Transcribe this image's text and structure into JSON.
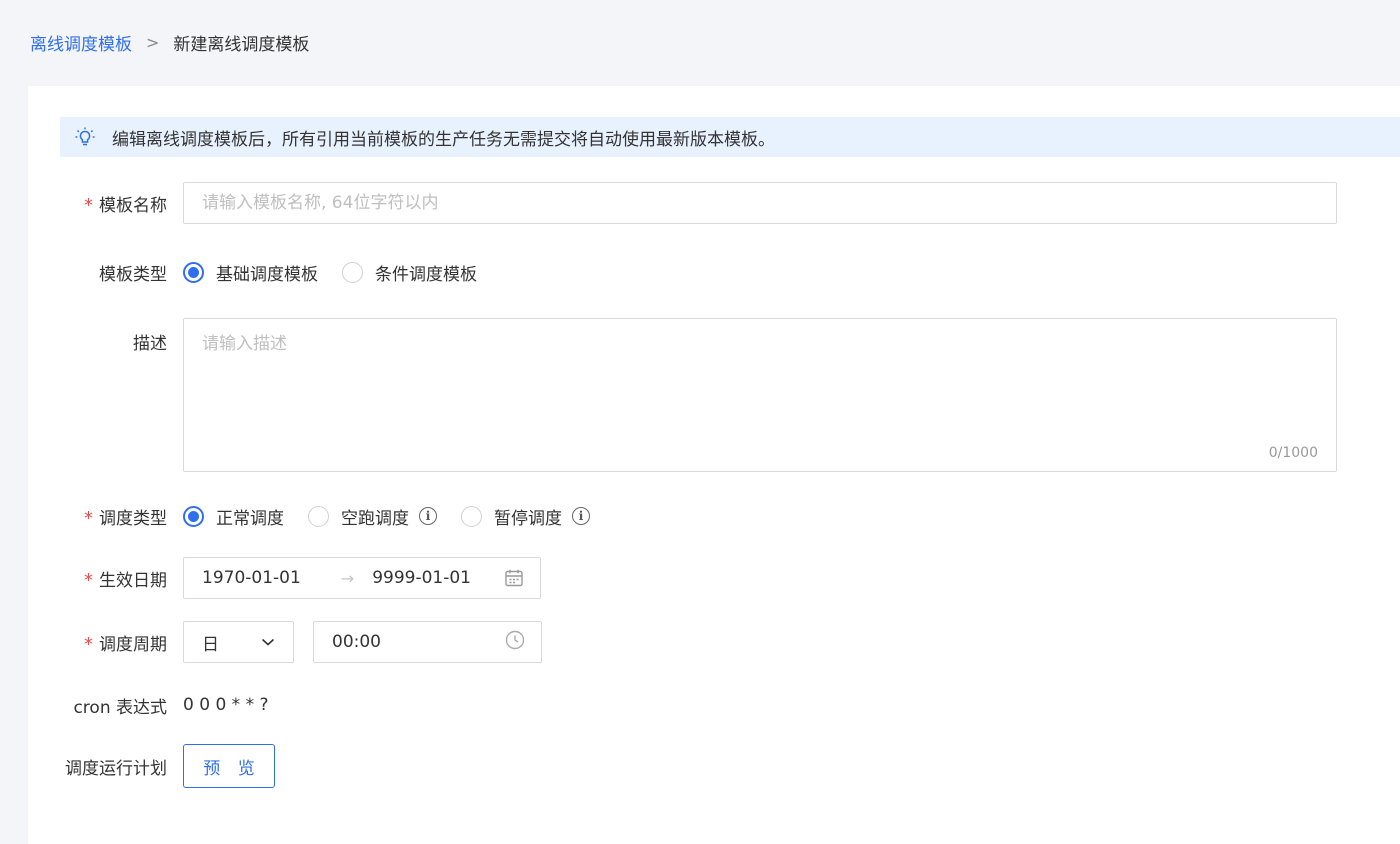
{
  "breadcrumb": {
    "parent": "离线调度模板",
    "separator": ">",
    "current": "新建离线调度模板"
  },
  "notice": {
    "icon": "lightbulb-icon",
    "text": "编辑离线调度模板后，所有引用当前模板的生产任务无需提交将自动使用最新版本模板。"
  },
  "form": {
    "name": {
      "label": "模板名称",
      "required": "*",
      "placeholder": "请输入模板名称, 64位字符以内",
      "value": ""
    },
    "template_type": {
      "label": "模板类型",
      "options": [
        {
          "label": "基础调度模板",
          "checked": true
        },
        {
          "label": "条件调度模板",
          "checked": false
        }
      ]
    },
    "description": {
      "label": "描述",
      "placeholder": "请输入描述",
      "value": "",
      "counter": "0/1000"
    },
    "schedule_type": {
      "label": "调度类型",
      "required": "*",
      "options": [
        {
          "label": "正常调度",
          "checked": true,
          "info": false
        },
        {
          "label": "空跑调度",
          "checked": false,
          "info": true
        },
        {
          "label": "暂停调度",
          "checked": false,
          "info": true
        }
      ]
    },
    "effective_date": {
      "label": "生效日期",
      "required": "*",
      "start": "1970-01-01",
      "arrow": "→",
      "end": "9999-01-01"
    },
    "schedule_cycle": {
      "label": "调度周期",
      "required": "*",
      "period": "日",
      "time": "00:00"
    },
    "cron": {
      "label": "cron 表达式",
      "value": "0 0 0 * * ?"
    },
    "run_plan": {
      "label": "调度运行计划",
      "button": "预 览"
    }
  },
  "colors": {
    "accent": "#2f6fed",
    "required": "#f04b4b",
    "notice_bg": "#e8f1fe",
    "page_bg": "#f3f5f9"
  }
}
